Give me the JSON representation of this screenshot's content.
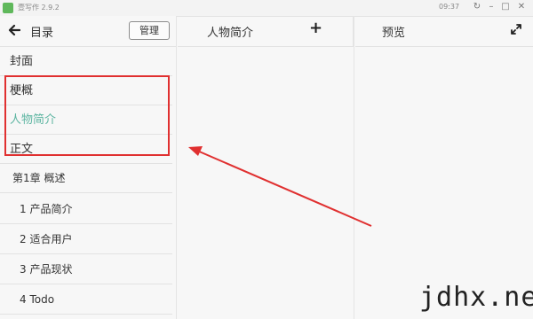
{
  "titlebar": {
    "app_title": "壹写作 2.9.2",
    "clock": "09:37"
  },
  "sidebar": {
    "title": "目录",
    "manage_label": "管理",
    "sections": [
      {
        "label": "封面"
      },
      {
        "label": "梗概"
      },
      {
        "label": "人物简介",
        "active": true
      },
      {
        "label": "正文"
      }
    ],
    "chapter": "第1章 概述",
    "items": [
      {
        "label": "1 产品简介"
      },
      {
        "label": "2 适合用户"
      },
      {
        "label": "3 产品现状"
      },
      {
        "label": "4 Todo"
      }
    ]
  },
  "editor": {
    "title": "人物简介",
    "add_icon": "plus-icon"
  },
  "preview": {
    "title": "预览",
    "expand_icon": "expand-icon"
  },
  "colors": {
    "active_accent": "#5cb5a1",
    "annotation": "#e03030",
    "app_icon": "#5fb85b"
  },
  "watermark": "jdhx.net"
}
